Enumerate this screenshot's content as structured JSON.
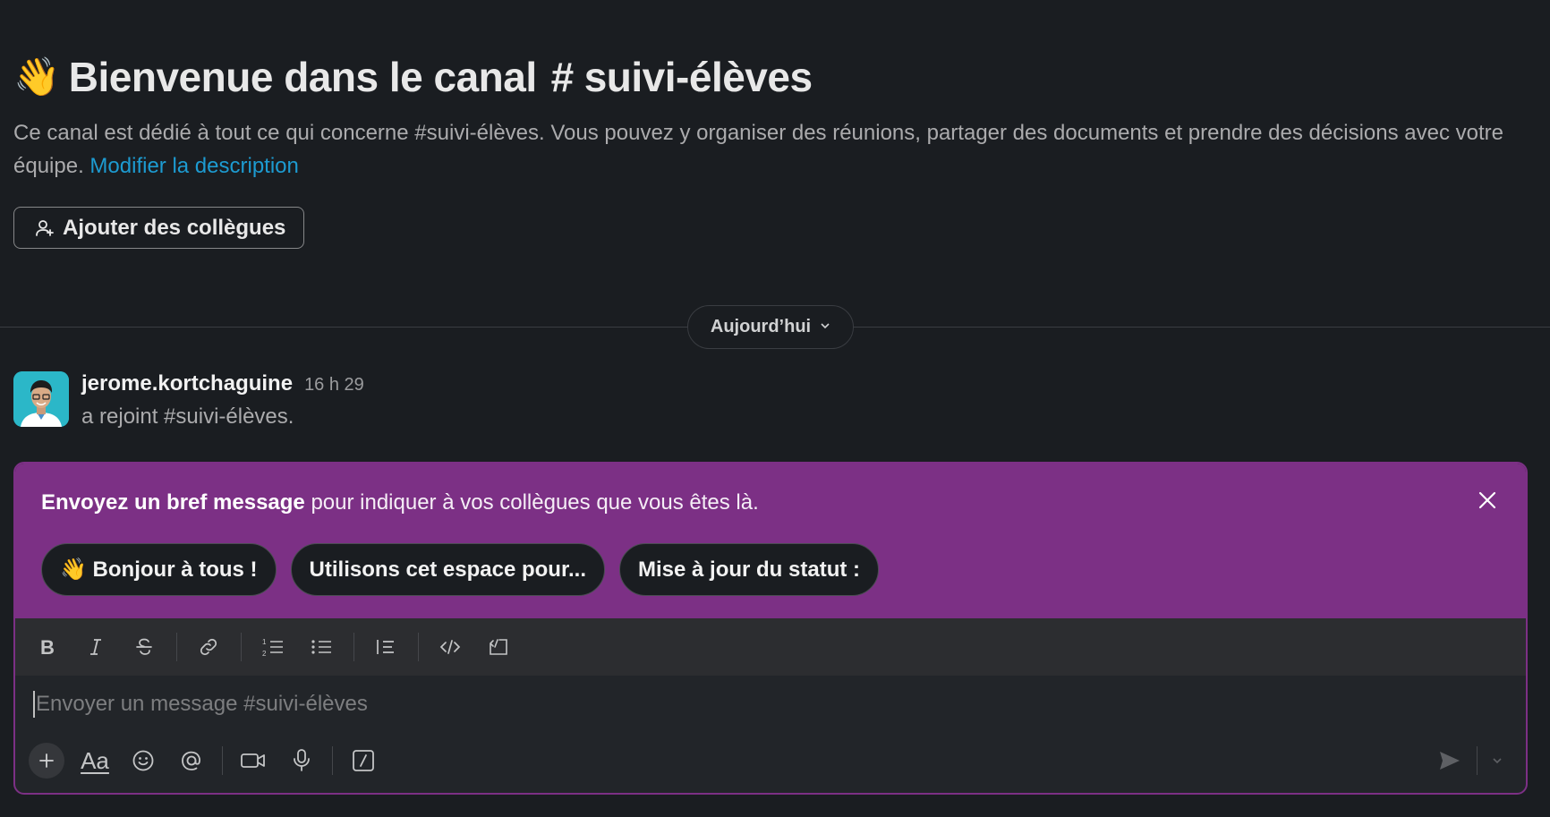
{
  "intro": {
    "wave_emoji": "👋",
    "title_prefix": "Bienvenue dans le canal",
    "hash": "#",
    "channel_name": "suivi-élèves",
    "description": "Ce canal est dédié à tout ce qui concerne #suivi-élèves. Vous pouvez y organiser des réunions, partager des documents et prendre des décisions avec votre équipe.",
    "edit_link": "Modifier la description"
  },
  "add_colleagues_label": "Ajouter des collègues",
  "divider": {
    "label": "Aujourd’hui"
  },
  "message": {
    "author": "jerome.kortchaguine",
    "time": "16 h 29",
    "text": "a rejoint #suivi-élèves."
  },
  "banner": {
    "bold_text": "Envoyez un bref message",
    "text": " pour indiquer à vos collègues que vous êtes là.",
    "chips": [
      "👋 Bonjour à tous !",
      "Utilisons cet espace pour...",
      "Mise à jour du statut :"
    ]
  },
  "composer": {
    "placeholder": "Envoyer un message #suivi-élèves",
    "format_label": "Aa"
  },
  "colors": {
    "background": "#1a1d21",
    "accent_purple": "#7c3085",
    "link_blue": "#1d9bd1",
    "avatar_bg": "#2bb7c8"
  },
  "icons": {
    "toolbar": [
      "bold-icon",
      "italic-icon",
      "strikethrough-icon",
      "link-icon",
      "ordered-list-icon",
      "bullet-list-icon",
      "blockquote-icon",
      "code-icon",
      "code-block-icon"
    ],
    "bottom": [
      "plus-icon",
      "text-format-icon",
      "emoji-icon",
      "mention-icon",
      "video-icon",
      "microphone-icon",
      "slash-command-icon",
      "send-icon",
      "chevron-down-icon"
    ]
  }
}
